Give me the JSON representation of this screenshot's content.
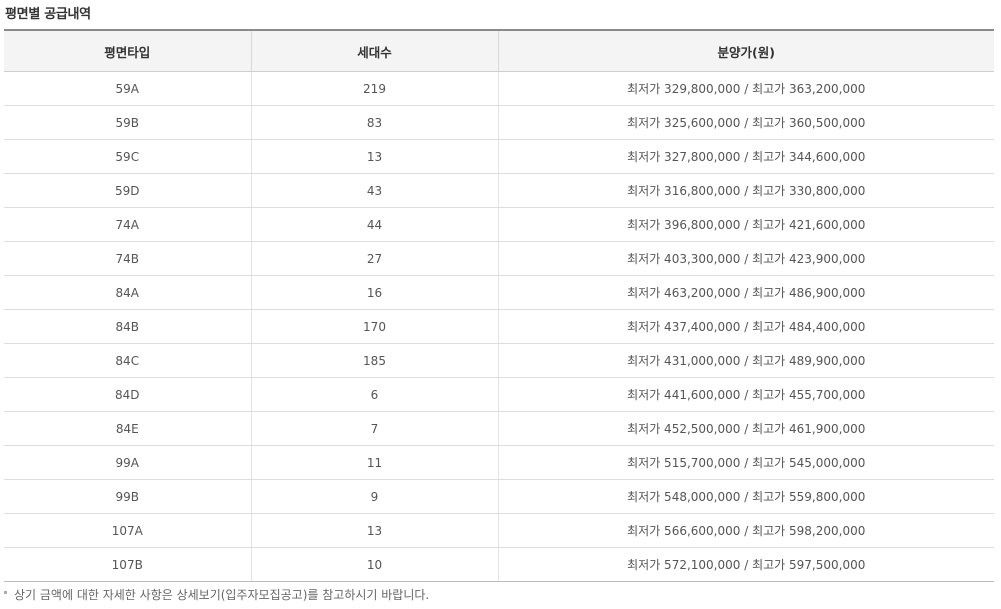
{
  "section_title": "평면별 공급내역",
  "table": {
    "headers": [
      "평면타입",
      "세대수",
      "분양가(원)"
    ],
    "rows": [
      {
        "type": "59A",
        "units": "219",
        "price": "최저가 329,800,000 / 최고가 363,200,000"
      },
      {
        "type": "59B",
        "units": "83",
        "price": "최저가 325,600,000 / 최고가 360,500,000"
      },
      {
        "type": "59C",
        "units": "13",
        "price": "최저가 327,800,000 / 최고가 344,600,000"
      },
      {
        "type": "59D",
        "units": "43",
        "price": "최저가 316,800,000 / 최고가 330,800,000"
      },
      {
        "type": "74A",
        "units": "44",
        "price": "최저가 396,800,000 / 최고가 421,600,000"
      },
      {
        "type": "74B",
        "units": "27",
        "price": "최저가 403,300,000 / 최고가 423,900,000"
      },
      {
        "type": "84A",
        "units": "16",
        "price": "최저가 463,200,000 / 최고가 486,900,000"
      },
      {
        "type": "84B",
        "units": "170",
        "price": "최저가 437,400,000 / 최고가 484,400,000"
      },
      {
        "type": "84C",
        "units": "185",
        "price": "최저가 431,000,000 / 최고가 489,900,000"
      },
      {
        "type": "84D",
        "units": "6",
        "price": "최저가 441,600,000 / 최고가 455,700,000"
      },
      {
        "type": "84E",
        "units": "7",
        "price": "최저가 452,500,000 / 최고가 461,900,000"
      },
      {
        "type": "99A",
        "units": "11",
        "price": "최저가 515,700,000 / 최고가 545,000,000"
      },
      {
        "type": "99B",
        "units": "9",
        "price": "최저가 548,000,000 / 최고가 559,800,000"
      },
      {
        "type": "107A",
        "units": "13",
        "price": "최저가 566,600,000 / 최고가 598,200,000"
      },
      {
        "type": "107B",
        "units": "10",
        "price": "최저가 572,100,000 / 최고가 597,500,000"
      }
    ]
  },
  "note": "상기 금액에 대한 자세한 사항은 상세보기(입주자모집공고)를 참고하시기 바랍니다."
}
